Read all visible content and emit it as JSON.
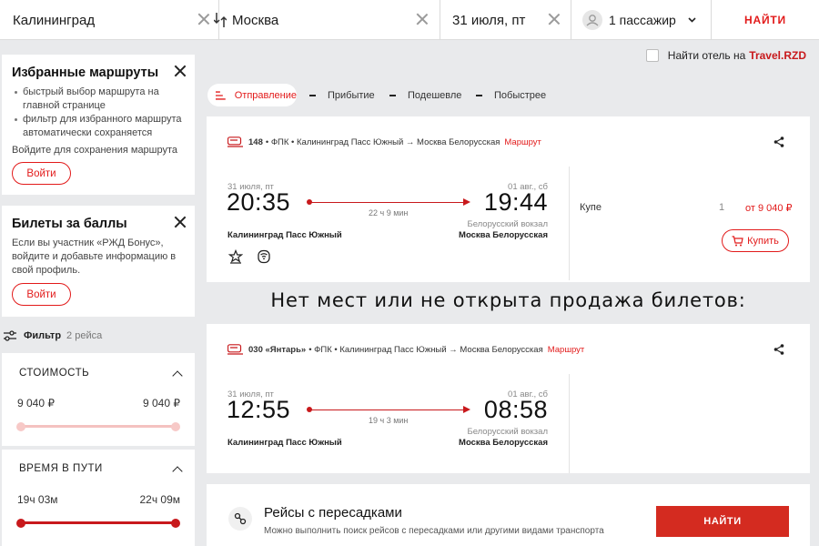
{
  "search": {
    "from": "Калининград",
    "to": "Москва",
    "date": "31 июля, пт",
    "passengers": "1 пассажир",
    "find_label": "НАЙТИ"
  },
  "hotel": {
    "label": "Найти отель на",
    "link": "Travel.RZD"
  },
  "sort": {
    "departure": "Отправление",
    "arrival": "Прибытие",
    "cheaper": "Подешевле",
    "faster": "Побыстрее"
  },
  "favorites": {
    "title": "Избранные маршруты",
    "bullets": [
      "быстрый выбор маршрута на главной странице",
      "фильтр для избранного маршрута автоматически сохраняется"
    ],
    "note": "Войдите для сохранения маршрута",
    "login_label": "Войти"
  },
  "bonus": {
    "title": "Билеты за баллы",
    "text": "Если вы участник «РЖД Бонус», войдите и добавьте информацию в свой профиль.",
    "login_label": "Войти"
  },
  "filter": {
    "title": "Фильтр",
    "count": "2 рейса",
    "cost": {
      "label": "СТОИМОСТЬ",
      "min": "9 040 ₽",
      "max": "9 040 ₽"
    },
    "duration": {
      "label": "ВРЕМЯ В ПУТИ",
      "min": "19ч 03м",
      "max": "22ч 09м"
    }
  },
  "trains": [
    {
      "number": "148",
      "route": "• ФПК • Калининград Пасс Южный → Москва Белорусская",
      "route_link": "Маршрут",
      "dep_date": "31 июля, пт",
      "dep_time": "20:35",
      "arr_date": "01 авг., сб",
      "arr_time": "19:44",
      "duration": "22 ч 9 мин",
      "arr_station_small": "Белорусский вокзал",
      "dep_station": "Калининград Пасс Южный",
      "arr_station": "Москва Белорусская",
      "car_type": "Купе",
      "seats": "1",
      "price": "от 9 040 ₽",
      "buy_label": "Купить"
    },
    {
      "number": "030 «Янтарь»",
      "route": "• ФПК • Калининград Пасс Южный → Москва Белорусская",
      "route_link": "Маршрут",
      "dep_date": "31 июля, пт",
      "dep_time": "12:55",
      "arr_date": "01 авг., сб",
      "arr_time": "08:58",
      "duration": "19 ч 3 мин",
      "arr_station_small": "Белорусский вокзал",
      "dep_station": "Калининград Пасс Южный",
      "arr_station": "Москва Белорусская"
    }
  ],
  "no_tickets": "Нет мест или не открыта продажа билетов:",
  "transfers": {
    "title": "Рейсы с пересадками",
    "subtitle": "Можно выполнить поиск рейсов с пересадками или другими видами транспорта",
    "find_label": "НАЙТИ"
  },
  "colors": {
    "accent": "#e21a1a",
    "background": "#e9eaec"
  },
  "icons": [
    "clear-icon",
    "swap-icon",
    "user-icon",
    "chevron-down-icon",
    "close-icon",
    "filter-icon",
    "chevron-up-icon",
    "sort-icon",
    "train-icon",
    "share-icon",
    "star-icon",
    "wifi-icon",
    "cart-icon",
    "transfer-icon"
  ]
}
